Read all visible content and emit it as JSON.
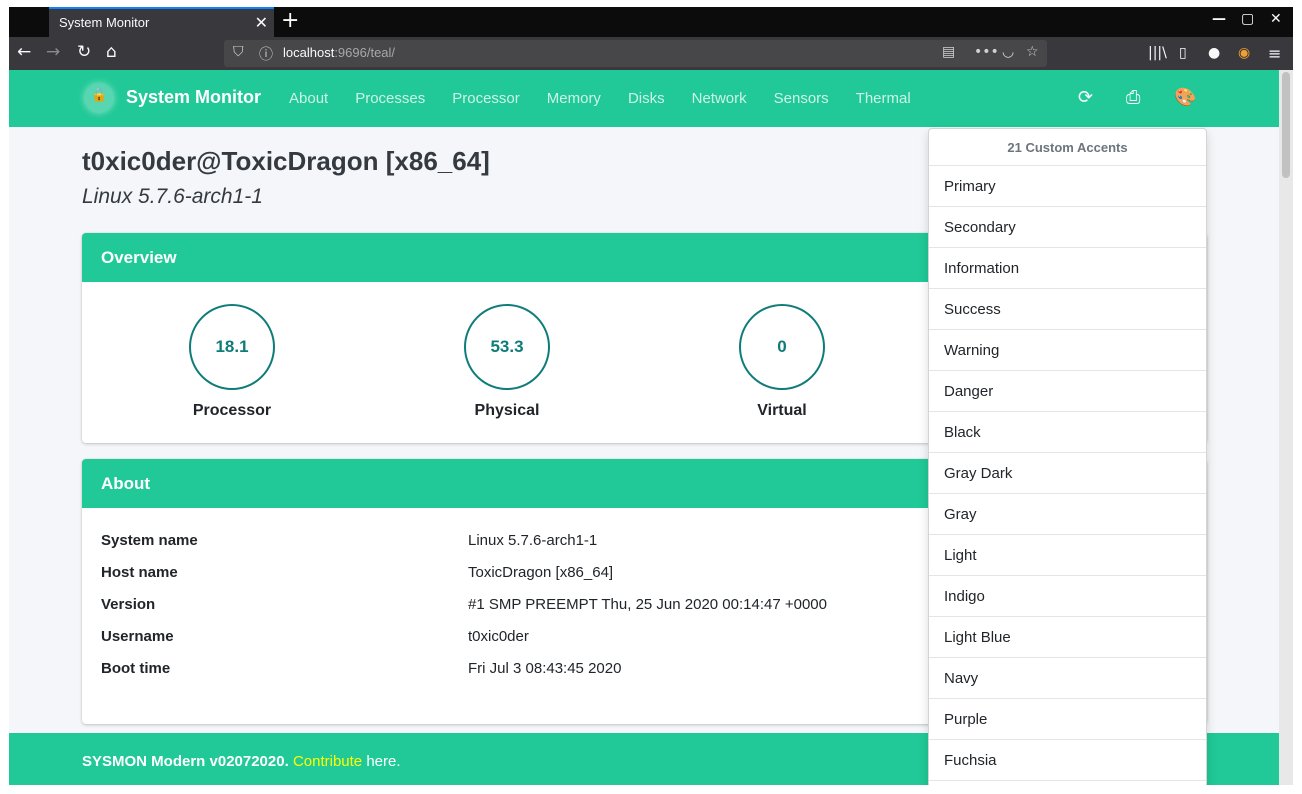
{
  "browser": {
    "tab_title": "System Monitor",
    "tab_close": "✕",
    "new_tab": "+",
    "url_host": "localhost",
    "url_rest": ":9696/teal/",
    "window_controls": {
      "minimize": "—",
      "maximize": "▢",
      "close": "✕"
    }
  },
  "nav": {
    "brand": "System Monitor",
    "links": [
      "About",
      "Processes",
      "Processor",
      "Memory",
      "Disks",
      "Network",
      "Sensors",
      "Thermal"
    ]
  },
  "header": {
    "title": "t0xic0der@ToxicDragon [x86_64]",
    "subtitle": "Linux 5.7.6-arch1-1"
  },
  "overview": {
    "title": "Overview",
    "gauges": [
      {
        "value": "18.1",
        "label": "Processor"
      },
      {
        "value": "53.3",
        "label": "Physical"
      },
      {
        "value": "0",
        "label": "Virtual"
      }
    ]
  },
  "about": {
    "title": "About",
    "rows": [
      {
        "key": "System name",
        "value": "Linux 5.7.6-arch1-1"
      },
      {
        "key": "Host name",
        "value": "ToxicDragon [x86_64]"
      },
      {
        "key": "Version",
        "value": "#1 SMP PREEMPT Thu, 25 Jun 2020 00:14:47 +0000"
      },
      {
        "key": "Username",
        "value": "t0xic0der"
      },
      {
        "key": "Boot time",
        "value": "Fri Jul 3 08:43:45 2020"
      }
    ]
  },
  "footer": {
    "prefix": "SYSMON Modern v02072020.",
    "link": "Contribute",
    "suffix": "here."
  },
  "accents": {
    "header": "21 Custom Accents",
    "items": [
      "Primary",
      "Secondary",
      "Information",
      "Success",
      "Warning",
      "Danger",
      "Black",
      "Gray Dark",
      "Gray",
      "Light",
      "Indigo",
      "Light Blue",
      "Navy",
      "Purple",
      "Fuchsia"
    ]
  },
  "colors": {
    "accent": "#20c997",
    "gauge": "#0f7c79",
    "link_highlight": "#ffff00"
  }
}
